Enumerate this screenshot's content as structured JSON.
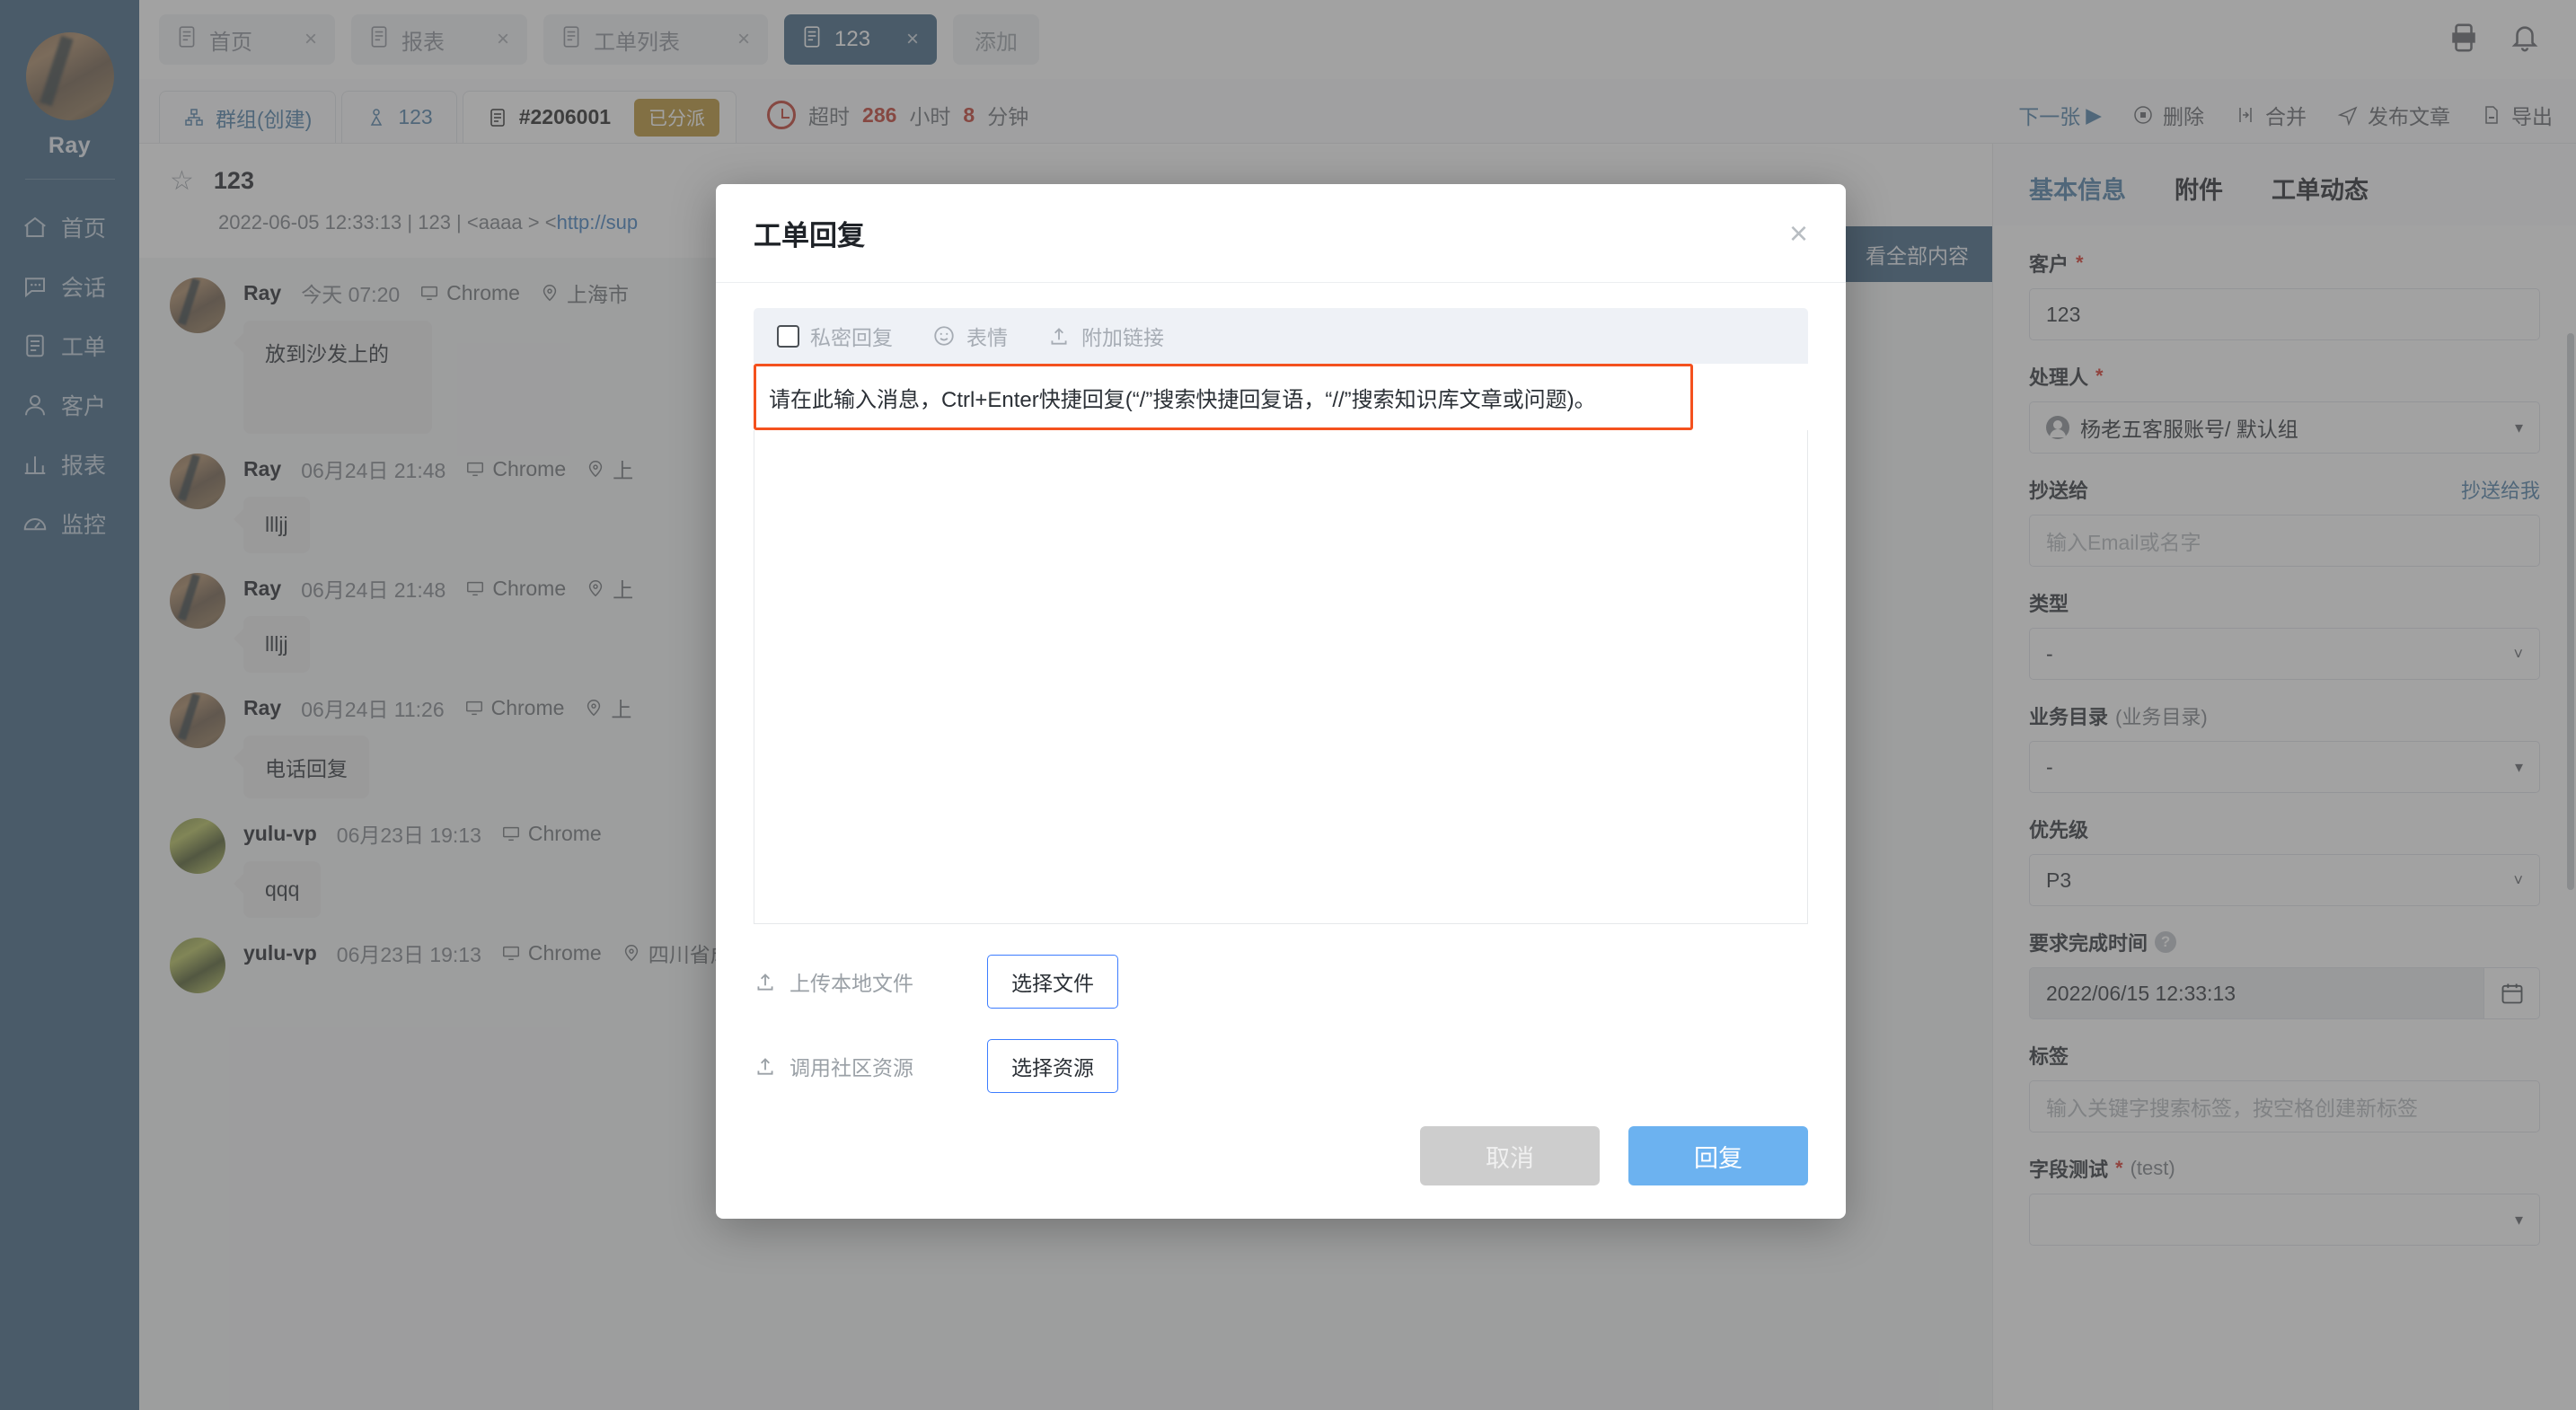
{
  "sidebar": {
    "user_name": "Ray",
    "items": [
      {
        "label": "首页",
        "icon": "home-icon"
      },
      {
        "label": "会话",
        "icon": "chat-icon"
      },
      {
        "label": "工单",
        "icon": "ticket-icon"
      },
      {
        "label": "客户",
        "icon": "user-icon"
      },
      {
        "label": "报表",
        "icon": "chart-icon"
      },
      {
        "label": "监控",
        "icon": "gauge-icon"
      }
    ]
  },
  "topbar": {
    "tabs": [
      {
        "label": "首页",
        "active": false,
        "close": "×"
      },
      {
        "label": "报表",
        "active": false,
        "close": "×"
      },
      {
        "label": "工单列表",
        "active": false,
        "close": "×"
      },
      {
        "label": "123",
        "active": true,
        "close": "×"
      }
    ],
    "add_label": "添加",
    "icons": [
      "app-icon",
      "bell-icon"
    ]
  },
  "subheader": {
    "chips": [
      {
        "label": "群组(创建)",
        "icon": "group-icon"
      },
      {
        "label": "123",
        "icon": "person-icon"
      }
    ],
    "ticket_id": "#2206001",
    "status_badge": "已分派",
    "overdue_prefix": "超时",
    "overdue_hours": "286",
    "overdue_hours_unit": "小时",
    "overdue_minutes": "8",
    "overdue_minutes_unit": "分钟",
    "next_label": "下一张",
    "actions": [
      {
        "label": "删除",
        "icon": "delete-icon"
      },
      {
        "label": "合并",
        "icon": "merge-icon"
      },
      {
        "label": "发布文章",
        "icon": "publish-icon"
      },
      {
        "label": "导出",
        "icon": "export-icon"
      }
    ]
  },
  "ticket": {
    "title": "123",
    "meta_plain": "2022-06-05 12:33:13 | 123 | <aaaa > <",
    "meta_link": "http://sup",
    "view_all_label": "看全部内容"
  },
  "messages": [
    {
      "author": "Ray",
      "time": "今天 07:20",
      "browser": "Chrome",
      "location": "上海市",
      "text": "放到沙发上的",
      "avatar": "ray",
      "tall": true
    },
    {
      "author": "Ray",
      "time": "06月24日 21:48",
      "browser": "Chrome",
      "location": "上",
      "text": "llljj",
      "avatar": "ray",
      "tall": false
    },
    {
      "author": "Ray",
      "time": "06月24日 21:48",
      "browser": "Chrome",
      "location": "上",
      "text": "llljj",
      "avatar": "ray",
      "tall": false
    },
    {
      "author": "Ray",
      "time": "06月24日 11:26",
      "browser": "Chrome",
      "location": "上",
      "text": "电话回复",
      "avatar": "ray",
      "tall": false
    },
    {
      "author": "yulu-vp",
      "time": "06月23日 19:13",
      "browser": "Chrome",
      "location": "",
      "text": "qqq",
      "avatar": "yulu",
      "tall": false
    },
    {
      "author": "yulu-vp",
      "time": "06月23日 19:13",
      "browser": "Chrome",
      "location": "四川省成都市",
      "text": "",
      "avatar": "yulu",
      "tall": false
    }
  ],
  "right_panel": {
    "tabs": [
      {
        "label": "基本信息",
        "active": true
      },
      {
        "label": "附件",
        "active": false
      },
      {
        "label": "工单动态",
        "active": false
      }
    ],
    "fields": [
      {
        "label": "客户",
        "required": true,
        "value": "123",
        "type": "text"
      },
      {
        "label": "处理人",
        "required": true,
        "value": "杨老五客服账号/ 默认组",
        "type": "person-select"
      },
      {
        "label": "抄送给",
        "required": false,
        "value": "",
        "placeholder": "输入Email或名字",
        "type": "text",
        "right_link": "抄送给我"
      },
      {
        "label": "类型",
        "required": false,
        "value": "-",
        "type": "select"
      },
      {
        "label": "业务目录",
        "sub": "(业务目录)",
        "required": false,
        "value": "-",
        "type": "select"
      },
      {
        "label": "优先级",
        "required": false,
        "value": "P3",
        "type": "select"
      },
      {
        "label": "要求完成时间",
        "required": false,
        "value": "2022/06/15 12:33:13",
        "type": "date",
        "help": "?"
      },
      {
        "label": "标签",
        "required": false,
        "value": "",
        "placeholder": "输入关键字搜索标签，按空格创建新标签",
        "type": "text"
      },
      {
        "label": "字段测试",
        "sub": "(test)",
        "required": true,
        "value": "",
        "type": "select"
      }
    ]
  },
  "modal": {
    "title": "工单回复",
    "close": "×",
    "toolbar": [
      {
        "label": "私密回复",
        "icon": "checkbox-icon"
      },
      {
        "label": "表情",
        "icon": "emoji-icon"
      },
      {
        "label": "附加链接",
        "icon": "upload-icon"
      }
    ],
    "input_placeholder": "请在此输入消息，Ctrl+Enter快捷回复(“/”搜索快捷回复语，“//”搜索知识库文章或问题)。",
    "upload_local_label": "上传本地文件",
    "choose_file_label": "选择文件",
    "community_resource_label": "调用社区资源",
    "choose_resource_label": "选择资源",
    "cancel_label": "取消",
    "submit_label": "回复"
  },
  "colors": {
    "brand": "#3c6382",
    "accent_link": "#4a7da6",
    "badge_assigned": "#b9912f",
    "overdue_red": "#c0392b",
    "input_highlight": "#f4511e",
    "primary_button": "#6cb2f0"
  }
}
